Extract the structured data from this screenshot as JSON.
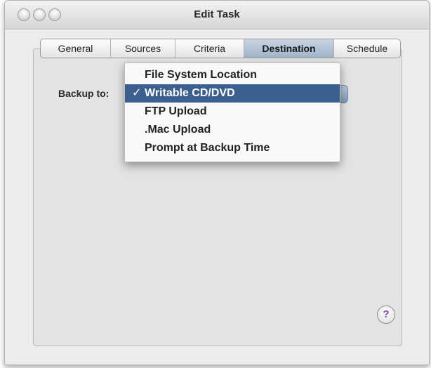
{
  "window": {
    "title": "Edit Task"
  },
  "tabs": [
    {
      "label": "General"
    },
    {
      "label": "Sources"
    },
    {
      "label": "Criteria"
    },
    {
      "label": "Destination",
      "active": true
    },
    {
      "label": "Schedule"
    }
  ],
  "destination": {
    "backup_label": "Backup to:",
    "selected": "Writable CD/DVD",
    "options": [
      "File System Location",
      "Writable CD/DVD",
      "FTP Upload",
      ".Mac Upload",
      "Prompt at Backup Time"
    ],
    "check_glyph": "✓"
  },
  "help": {
    "label": "?"
  },
  "colors": {
    "selection": "#3b5f8f",
    "active_tab": "#aabcd0",
    "help_glyph": "#8a3fb8"
  }
}
